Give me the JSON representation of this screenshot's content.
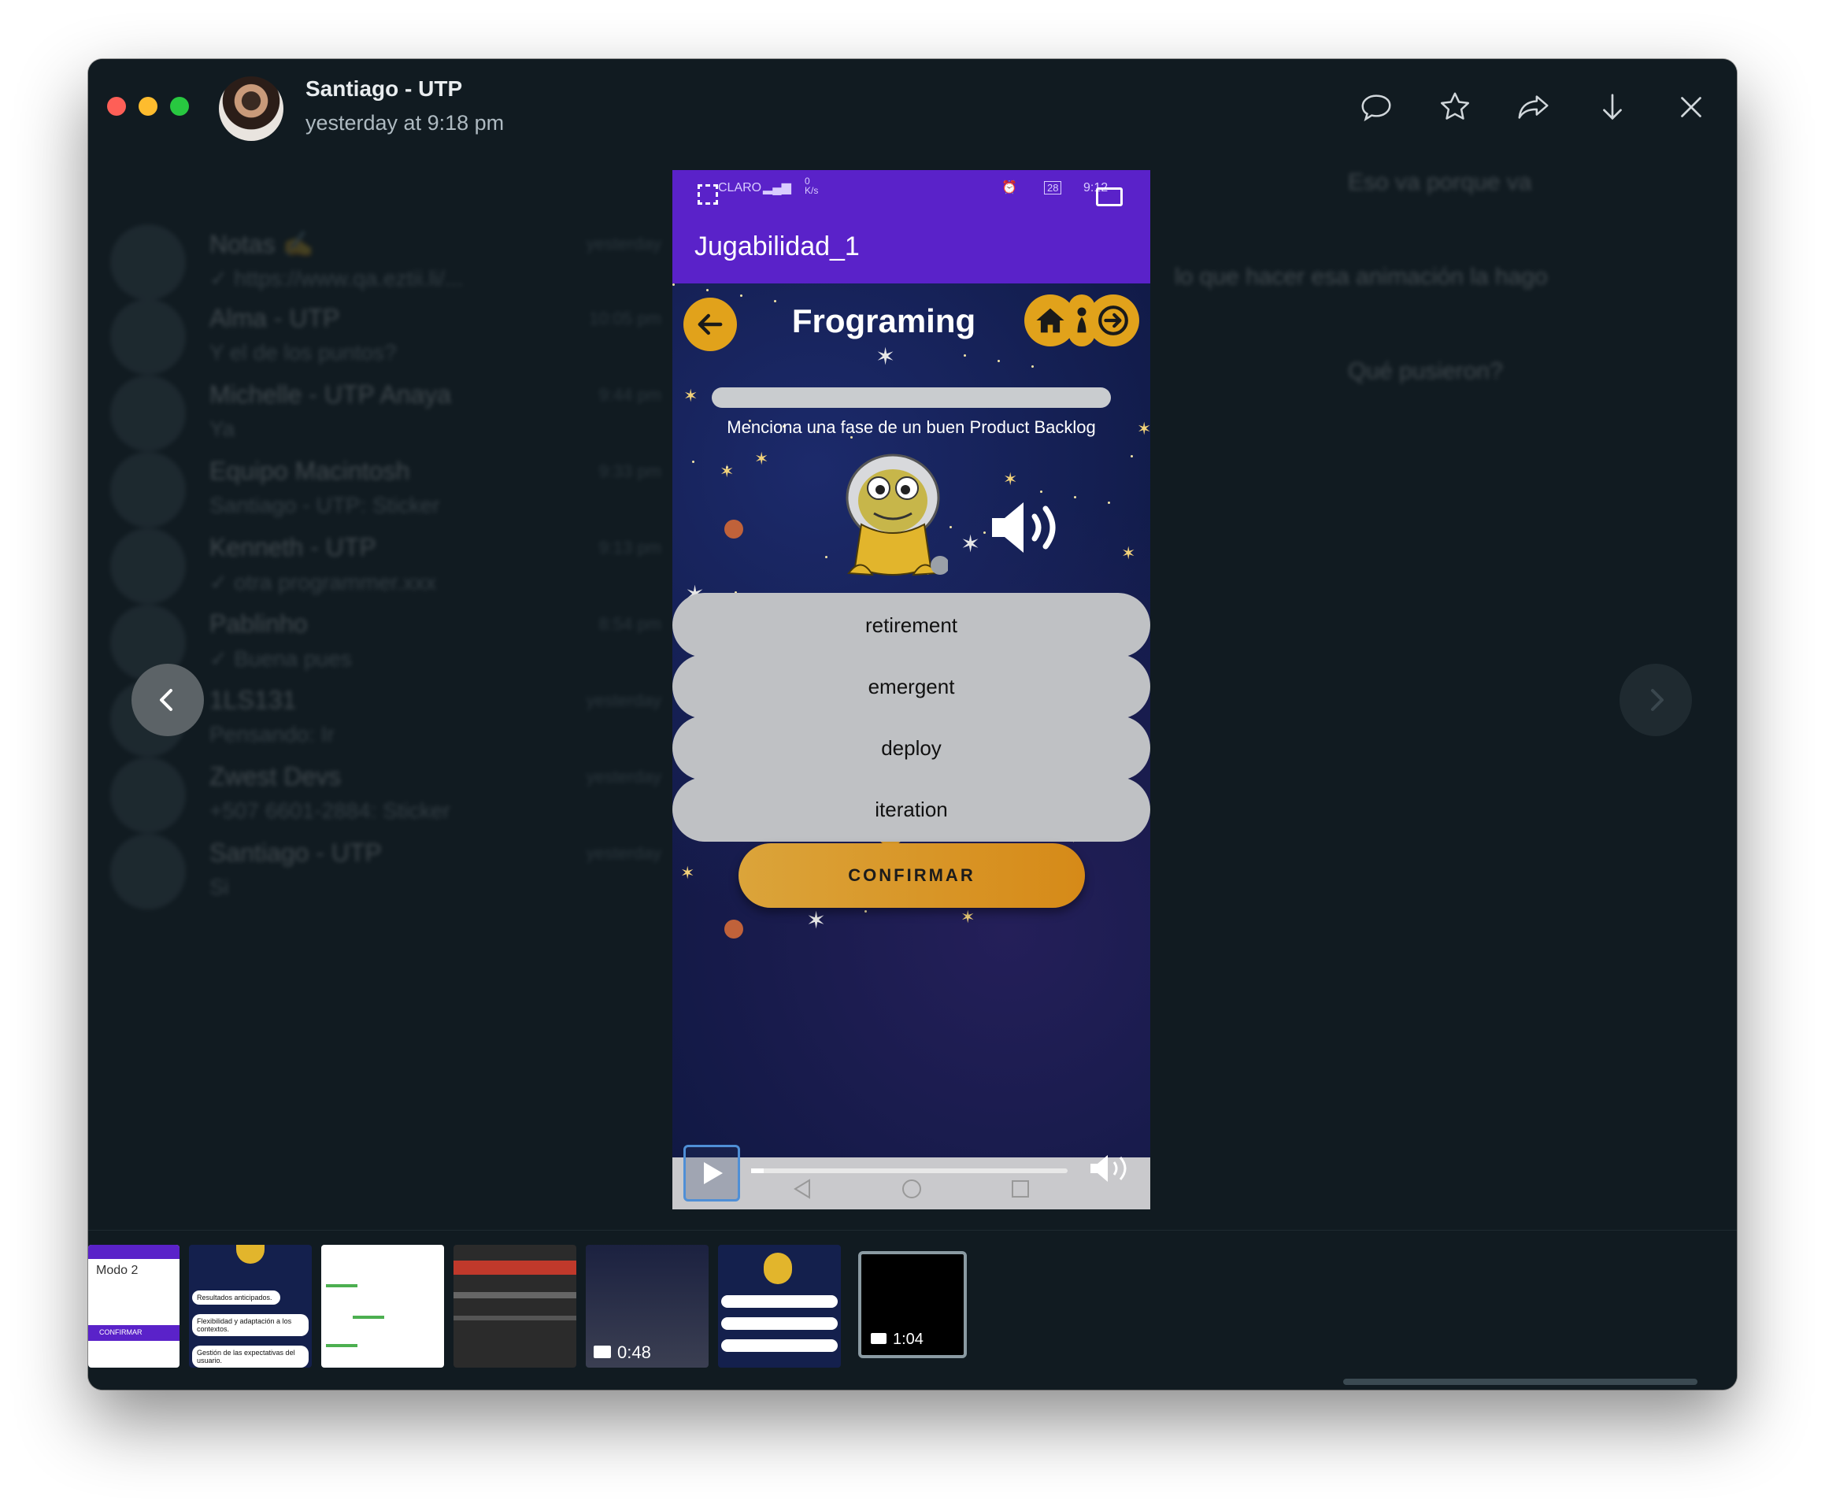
{
  "header": {
    "contact_name": "Santiago - UTP",
    "timestamp": "yesterday at 9:18 pm",
    "actions": [
      "reply-icon",
      "star-icon",
      "forward-icon",
      "download-icon",
      "close-icon"
    ]
  },
  "background_chats": [
    {
      "title": "Notas ✍️",
      "subtitle": "✓ https://www.qa.eztii.li/...",
      "time": "yesterday"
    },
    {
      "title": "Alma - UTP",
      "subtitle": "Y el de los puntos?",
      "time": "10:05 pm"
    },
    {
      "title": "Michelle - UTP Anaya",
      "subtitle": "Ya",
      "time": "9:44 pm"
    },
    {
      "title": "Equipo Macintosh",
      "subtitle": "Santiago - UTP: Sticker",
      "time": "9:33 pm"
    },
    {
      "title": "Kenneth - UTP",
      "subtitle": "✓ otra programmer.xxx",
      "time": "9:13 pm"
    },
    {
      "title": "Pablinho",
      "subtitle": "✓ Buena pues",
      "time": "8:54 pm"
    },
    {
      "title": "1LS131",
      "subtitle": "Pensando: Ir",
      "time": "yesterday"
    },
    {
      "title": "Zwest Devs",
      "subtitle": "+507 6601-2884: Sticker",
      "time": "yesterday"
    },
    {
      "title": "Santiago - UTP",
      "subtitle": "Si",
      "time": "yesterday"
    }
  ],
  "background_messages": [
    "Eso va porque va",
    "lo que hacer esa animación la hago",
    "Qué pusieron?"
  ],
  "phone": {
    "status_carrier": "CLARO",
    "status_speed": "0 K/s",
    "status_battery": "28",
    "status_time": "9:12",
    "app_title": "Jugabilidad_1",
    "game_title": "Frograming",
    "progress": 0.0,
    "question": "Menciona una fase de un buen Product Backlog",
    "answers": [
      "retirement",
      "emergent",
      "deploy",
      "iteration"
    ],
    "confirm_label": "CONFIRMAR"
  },
  "video": {
    "playback_progress": 0.04
  },
  "thumbnails": [
    {
      "kind": "image",
      "label": "Modo 2",
      "sub": "CONFIRMAR"
    },
    {
      "kind": "image",
      "label": "",
      "items": [
        "Resultados anticipados.",
        "Flexibilidad y adaptación a los contextos.",
        "Gestión de las expectativas del usuario."
      ]
    },
    {
      "kind": "image",
      "label": ""
    },
    {
      "kind": "image",
      "label": ""
    },
    {
      "kind": "video",
      "label": "0:48"
    },
    {
      "kind": "image",
      "label": ""
    },
    {
      "kind": "video",
      "label": "1:04",
      "selected": true
    }
  ],
  "colors": {
    "window_bg": "#111b21",
    "app_bar": "#5a22c9",
    "accent_gold": "#e1a21b",
    "answer_bg": "#bfc1c4"
  }
}
